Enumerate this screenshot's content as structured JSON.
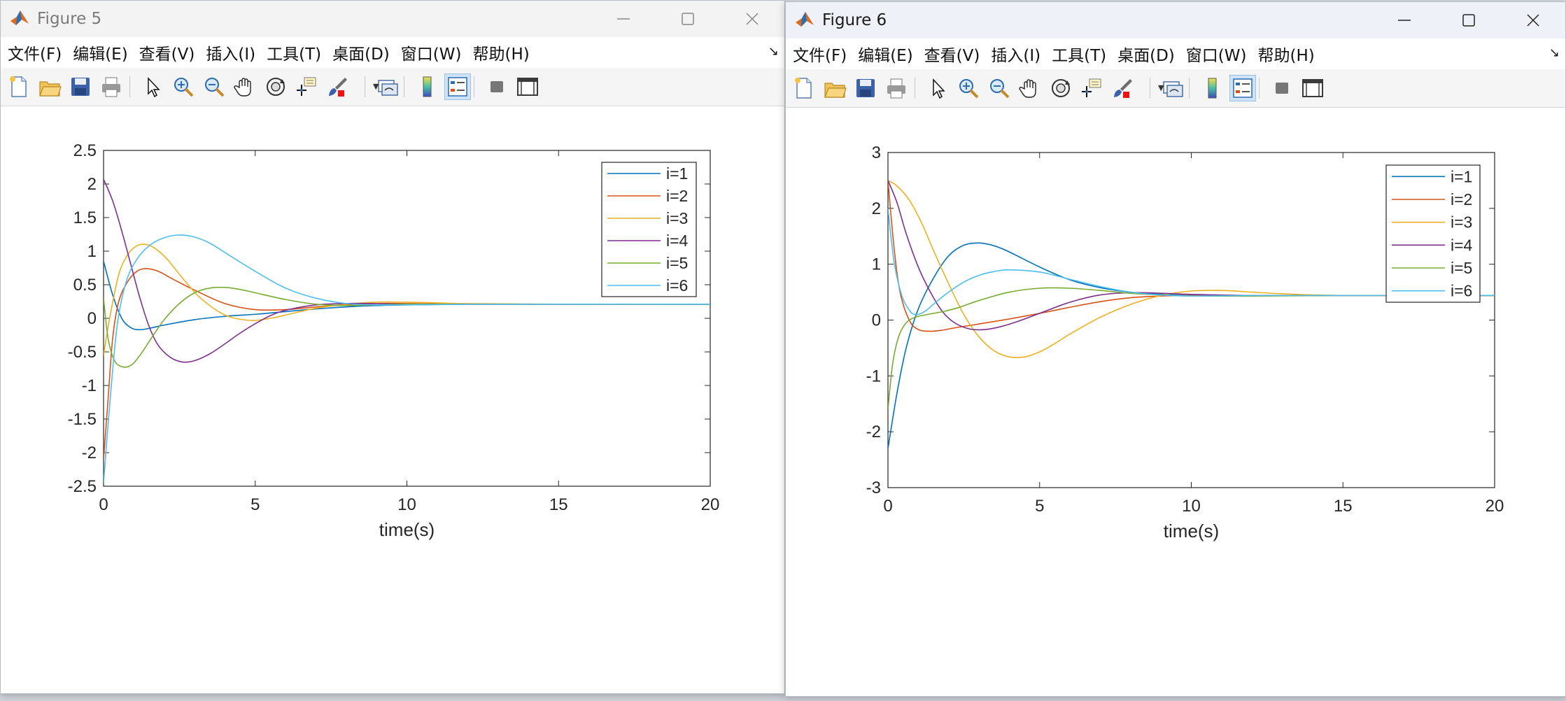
{
  "windows": [
    {
      "title": "Figure 5",
      "menu": [
        "文件(F)",
        "编辑(E)",
        "查看(V)",
        "插入(I)",
        "工具(T)",
        "桌面(D)",
        "窗口(W)",
        "帮助(H)"
      ],
      "toolbar_icons": [
        "new-figure-icon",
        "open-file-icon",
        "save-icon",
        "print-icon",
        "select-arrow-icon",
        "zoom-in-icon",
        "zoom-out-icon",
        "pan-hand-icon",
        "rotate-3d-icon",
        "data-cursor-icon",
        "brush-icon",
        "link-plot-icon",
        "colorbar-icon",
        "legend-icon",
        "hide-plot-tools-icon",
        "show-plot-tools-icon"
      ],
      "chart_data": {
        "type": "line",
        "xlabel": "time(s)",
        "ylabel": "",
        "xlim": [
          0,
          20
        ],
        "ylim": [
          -2.5,
          2.5
        ],
        "xticks": [
          "0",
          "5",
          "10",
          "15",
          "20"
        ],
        "yticks": [
          "-2.5",
          "-2",
          "-1.5",
          "-1",
          "-0.5",
          "0",
          "0.5",
          "1",
          "1.5",
          "2",
          "2.5"
        ],
        "legend_position": "top-right",
        "grid": false,
        "series": [
          {
            "name": "i=1",
            "color": "#0072BD",
            "x": [
              0,
              0.3,
              0.6,
              0.9,
              1.2,
              1.6,
              2,
              3,
              4,
              5,
              6,
              7,
              8,
              9,
              10,
              12,
              15,
              20
            ],
            "y": [
              0.85,
              0.35,
              0.0,
              -0.14,
              -0.17,
              -0.14,
              -0.1,
              -0.02,
              0.03,
              0.06,
              0.1,
              0.14,
              0.17,
              0.19,
              0.2,
              0.21,
              0.21,
              0.21
            ]
          },
          {
            "name": "i=2",
            "color": "#D95319",
            "x": [
              0,
              0.15,
              0.3,
              0.5,
              0.8,
              1.1,
              1.4,
              1.8,
              2.3,
              3,
              4,
              5,
              6,
              7,
              8,
              9,
              10,
              12,
              15,
              20
            ],
            "y": [
              -2.1,
              -1.2,
              -0.3,
              0.25,
              0.55,
              0.7,
              0.74,
              0.7,
              0.58,
              0.42,
              0.22,
              0.13,
              0.13,
              0.17,
              0.2,
              0.22,
              0.22,
              0.21,
              0.21,
              0.21
            ]
          },
          {
            "name": "i=3",
            "color": "#EDB120",
            "x": [
              0,
              0.2,
              0.5,
              0.8,
              1.1,
              1.4,
              1.7,
              2.1,
              2.6,
              3.2,
              4,
              4.8,
              5.5,
              6.2,
              7,
              8,
              9,
              10,
              11,
              12,
              15,
              20
            ],
            "y": [
              -0.55,
              0.0,
              0.65,
              0.95,
              1.08,
              1.1,
              1.04,
              0.88,
              0.6,
              0.3,
              0.05,
              -0.03,
              0.0,
              0.07,
              0.15,
              0.21,
              0.24,
              0.24,
              0.23,
              0.22,
              0.21,
              0.21
            ]
          },
          {
            "name": "i=4",
            "color": "#7E2F8E",
            "x": [
              0,
              0.3,
              0.6,
              0.9,
              1.2,
              1.5,
              1.8,
              2.2,
              2.6,
              3,
              3.5,
              4,
              4.5,
              5,
              5.5,
              6,
              7,
              8,
              9,
              10,
              12,
              15,
              20
            ],
            "y": [
              2.07,
              1.75,
              1.3,
              0.8,
              0.3,
              -0.12,
              -0.4,
              -0.58,
              -0.65,
              -0.63,
              -0.53,
              -0.38,
              -0.22,
              -0.08,
              0.04,
              0.12,
              0.2,
              0.22,
              0.22,
              0.21,
              0.21,
              0.21,
              0.21
            ]
          },
          {
            "name": "i=5",
            "color": "#77AC30",
            "x": [
              0,
              0.15,
              0.35,
              0.6,
              0.9,
              1.2,
              1.6,
              2,
              2.5,
              3,
              3.5,
              4,
              4.5,
              5,
              6,
              7,
              8,
              9,
              10,
              12,
              15,
              20
            ],
            "y": [
              0.3,
              -0.3,
              -0.62,
              -0.72,
              -0.7,
              -0.55,
              -0.28,
              -0.02,
              0.22,
              0.38,
              0.45,
              0.46,
              0.43,
              0.38,
              0.28,
              0.21,
              0.19,
              0.2,
              0.21,
              0.21,
              0.21,
              0.21
            ]
          },
          {
            "name": "i=6",
            "color": "#4DBEEE",
            "x": [
              0,
              0.2,
              0.45,
              0.75,
              1.1,
              1.5,
              2,
              2.5,
              3,
              3.5,
              4,
              5,
              6,
              7,
              8,
              9,
              10,
              12,
              15,
              20
            ],
            "y": [
              -2.45,
              -1.3,
              -0.1,
              0.55,
              0.88,
              1.08,
              1.2,
              1.24,
              1.21,
              1.12,
              0.98,
              0.7,
              0.45,
              0.3,
              0.22,
              0.2,
              0.2,
              0.21,
              0.21,
              0.21
            ]
          }
        ]
      }
    },
    {
      "title": "Figure 6",
      "menu": [
        "文件(F)",
        "编辑(E)",
        "查看(V)",
        "插入(I)",
        "工具(T)",
        "桌面(D)",
        "窗口(W)",
        "帮助(H)"
      ],
      "toolbar_icons": [
        "new-figure-icon",
        "open-file-icon",
        "save-icon",
        "print-icon",
        "select-arrow-icon",
        "zoom-in-icon",
        "zoom-out-icon",
        "pan-hand-icon",
        "rotate-3d-icon",
        "data-cursor-icon",
        "brush-icon",
        "link-plot-icon",
        "colorbar-icon",
        "legend-icon",
        "hide-plot-tools-icon",
        "show-plot-tools-icon"
      ],
      "chart_data": {
        "type": "line",
        "xlabel": "time(s)",
        "ylabel": "",
        "xlim": [
          0,
          20
        ],
        "ylim": [
          -3,
          3
        ],
        "xticks": [
          "0",
          "5",
          "10",
          "15",
          "20"
        ],
        "yticks": [
          "-3",
          "-2",
          "-1",
          "0",
          "1",
          "2",
          "3"
        ],
        "legend_position": "top-right",
        "grid": false,
        "series": [
          {
            "name": "i=1",
            "color": "#0072BD",
            "x": [
              0,
              0.3,
              0.6,
              1,
              1.5,
              2,
              2.5,
              3,
              3.5,
              4,
              5,
              6,
              7,
              8,
              9,
              10,
              12,
              15,
              20
            ],
            "y": [
              -2.3,
              -1.3,
              -0.5,
              0.2,
              0.75,
              1.15,
              1.34,
              1.38,
              1.33,
              1.22,
              0.95,
              0.72,
              0.58,
              0.5,
              0.46,
              0.44,
              0.44,
              0.44,
              0.44
            ]
          },
          {
            "name": "i=2",
            "color": "#D95319",
            "x": [
              0,
              0.2,
              0.4,
              0.7,
              1,
              1.4,
              1.8,
              2.3,
              3,
              4,
              5,
              6,
              7,
              8,
              9,
              10,
              12,
              15,
              20
            ],
            "y": [
              2.5,
              1.3,
              0.5,
              0.0,
              -0.17,
              -0.2,
              -0.18,
              -0.13,
              -0.07,
              0.02,
              0.12,
              0.23,
              0.33,
              0.4,
              0.43,
              0.44,
              0.44,
              0.44,
              0.44
            ]
          },
          {
            "name": "i=3",
            "color": "#EDB120",
            "x": [
              0,
              0.3,
              0.7,
              1.1,
              1.5,
              2,
              2.5,
              3,
              3.5,
              4,
              4.5,
              5,
              5.5,
              6,
              7,
              8,
              9,
              10,
              11,
              12,
              13,
              15,
              20
            ],
            "y": [
              2.5,
              2.4,
              2.15,
              1.75,
              1.25,
              0.65,
              0.1,
              -0.3,
              -0.55,
              -0.66,
              -0.66,
              -0.57,
              -0.42,
              -0.25,
              0.05,
              0.28,
              0.44,
              0.52,
              0.53,
              0.5,
              0.47,
              0.44,
              0.44
            ]
          },
          {
            "name": "i=4",
            "color": "#7E2F8E",
            "x": [
              0,
              0.3,
              0.6,
              1,
              1.4,
              1.8,
              2.2,
              2.7,
              3.2,
              3.7,
              4.3,
              5,
              6,
              7,
              8,
              9,
              10,
              12,
              15,
              20
            ],
            "y": [
              2.5,
              2.1,
              1.55,
              0.95,
              0.5,
              0.15,
              -0.05,
              -0.16,
              -0.17,
              -0.12,
              -0.02,
              0.12,
              0.32,
              0.45,
              0.49,
              0.48,
              0.46,
              0.44,
              0.44,
              0.44
            ]
          },
          {
            "name": "i=5",
            "color": "#77AC30",
            "x": [
              0,
              0.15,
              0.35,
              0.6,
              0.9,
              1.3,
              1.8,
              2.3,
              3,
              4,
              5,
              6,
              7,
              8,
              9,
              10,
              12,
              15,
              20
            ],
            "y": [
              -1.6,
              -0.8,
              -0.3,
              -0.05,
              0.05,
              0.1,
              0.15,
              0.22,
              0.35,
              0.5,
              0.57,
              0.57,
              0.53,
              0.48,
              0.45,
              0.43,
              0.43,
              0.44,
              0.44
            ]
          },
          {
            "name": "i=6",
            "color": "#4DBEEE",
            "x": [
              0,
              0.2,
              0.45,
              0.7,
              0.9,
              1.2,
              1.6,
              2,
              2.5,
              3,
              3.5,
              4,
              5,
              6,
              7,
              8,
              9,
              10,
              12,
              15,
              20
            ],
            "y": [
              2.0,
              1.05,
              0.45,
              0.18,
              0.1,
              0.15,
              0.33,
              0.5,
              0.68,
              0.8,
              0.87,
              0.9,
              0.86,
              0.73,
              0.6,
              0.5,
              0.45,
              0.43,
              0.44,
              0.44,
              0.44
            ]
          }
        ]
      }
    }
  ]
}
